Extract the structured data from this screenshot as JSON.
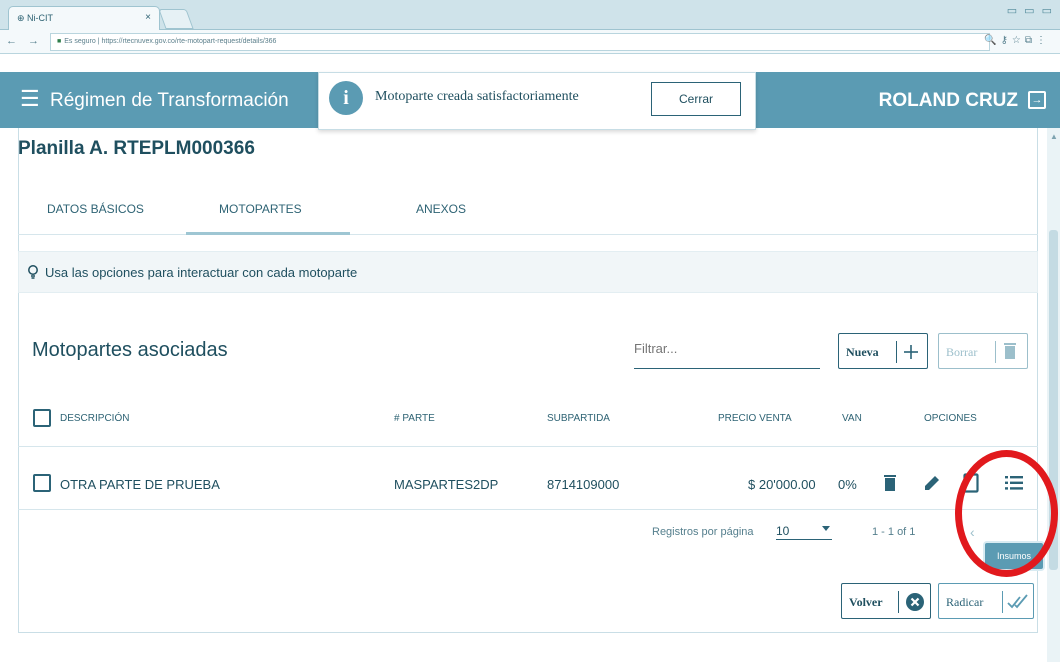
{
  "browser": {
    "tab_title": "Ni-CIT",
    "tab_close": "×",
    "url_secure": "Es seguro",
    "url": "https://rtecnuvex.gov.co/rte-motopart-request/details/366",
    "window_controls": "▭ ▭ ▭",
    "nav_icons": "← → C"
  },
  "header": {
    "title": "Régimen de Transformación",
    "user_name": "ROLAND CRUZ"
  },
  "toast": {
    "message": "Motoparte creada satisfactoriamente",
    "close_label": "Cerrar"
  },
  "page": {
    "partial_title": "Planilla A. RTEPLM000366"
  },
  "tabs": [
    {
      "label": "DATOS BÁSICOS",
      "active": false
    },
    {
      "label": "MOTOPARTES",
      "active": true
    },
    {
      "label": "ANEXOS",
      "active": false
    }
  ],
  "hint": {
    "text": "Usa las opciones para interactuar con cada motoparte",
    "icon": "lightbulb-icon"
  },
  "section": {
    "title": "Motopartes asociadas",
    "filter_placeholder": "Filtrar...",
    "new_label": "Nueva",
    "delete_label": "Borrar"
  },
  "table": {
    "headers": [
      "DESCRIPCIÓN",
      "# PARTE",
      "SUBPARTIDA",
      "PRECIO VENTA",
      "VAN",
      "OPCIONES"
    ],
    "rows": [
      {
        "descripcion": "OTRA PARTE DE PRUEBA",
        "parte": "MASPARTES2DP",
        "subpartida": "8714109000",
        "precio_venta": "$ 20'000.00",
        "van": "0%"
      }
    ]
  },
  "pagination": {
    "label": "Registros por página",
    "per_page": "10",
    "range": "1 - 1 of 1"
  },
  "tooltip": {
    "text": "Insumos"
  },
  "actions": {
    "back_label": "Volver",
    "submit_label": "Radicar"
  },
  "colors": {
    "primary": "#5b9bb3",
    "text": "#1f4f5f",
    "highlight_circle": "#e1191d"
  }
}
